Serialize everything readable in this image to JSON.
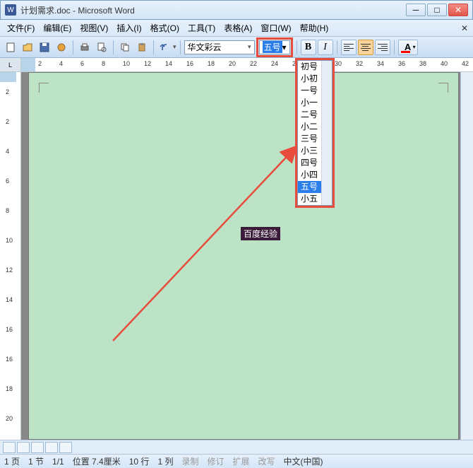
{
  "title": "计划需求.doc - Microsoft Word",
  "menu": {
    "file": "文件(F)",
    "edit": "编辑(E)",
    "view": "视图(V)",
    "insert": "插入(I)",
    "format": "格式(O)",
    "tools": "工具(T)",
    "table": "表格(A)",
    "window": "窗口(W)",
    "help": "帮助(H)"
  },
  "toolbar": {
    "font_name": "华文彩云",
    "font_size_selected": "五号",
    "bold": "B",
    "italic": "I",
    "fontcolor_letter": "A"
  },
  "font_sizes": [
    "初号",
    "小初",
    "一号",
    "小一",
    "二号",
    "小二",
    "三号",
    "小三",
    "四号",
    "小四",
    "五号",
    "小五"
  ],
  "font_size_highlight": "五号",
  "ruler_h": [
    "2",
    "4",
    "6",
    "8",
    "10",
    "12",
    "14",
    "16",
    "18",
    "20",
    "22",
    "24",
    "26",
    "28",
    "30",
    "32",
    "34",
    "36",
    "38",
    "40",
    "42"
  ],
  "ruler_v": [
    "2",
    "2",
    "4",
    "6",
    "8",
    "10",
    "12",
    "14",
    "16",
    "16",
    "18",
    "20"
  ],
  "document_text": "百度经验",
  "status": {
    "page": "1 页",
    "section": "1 节",
    "pages": "1/1",
    "position": "位置 7.4厘米",
    "line": "10 行",
    "column": "1 列",
    "rec": "录制",
    "rev": "修订",
    "ext": "扩展",
    "ovr": "改写",
    "lang": "中文(中国)"
  },
  "ruler_corner": "L"
}
